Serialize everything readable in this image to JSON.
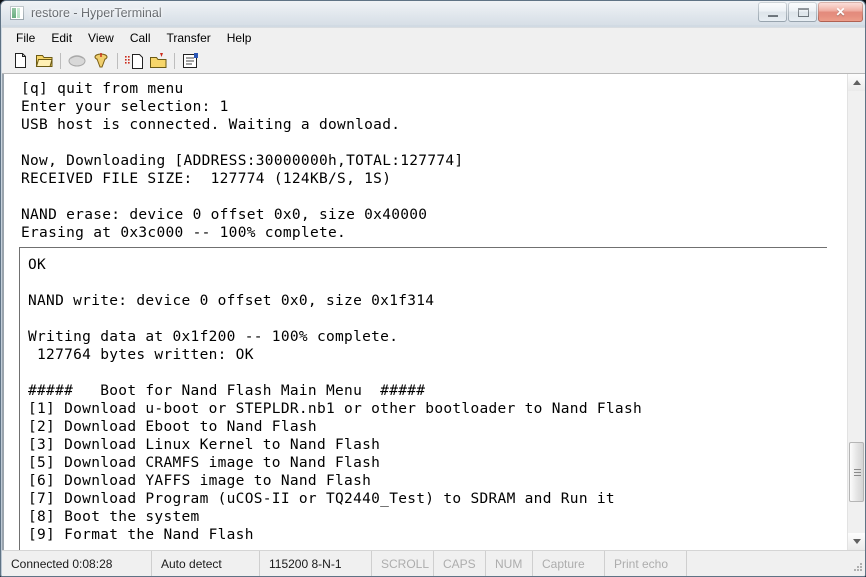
{
  "window": {
    "title": "restore - HyperTerminal",
    "icon": "hyperterminal-icon",
    "buttons": {
      "minimize": "minimize-button",
      "maximize": "maximize-button",
      "close": "✕"
    }
  },
  "menubar": {
    "items": [
      "File",
      "Edit",
      "View",
      "Call",
      "Transfer",
      "Help"
    ]
  },
  "toolbar": {
    "buttons": [
      {
        "name": "new-connection-icon",
        "title": "New"
      },
      {
        "name": "open-folder-icon",
        "title": "Open"
      },
      {
        "name": "call-icon",
        "title": "Call"
      },
      {
        "name": "disconnect-icon",
        "title": "Disconnect"
      },
      {
        "name": "send-file-icon",
        "title": "Send"
      },
      {
        "name": "receive-file-icon",
        "title": "Receive"
      },
      {
        "name": "properties-icon",
        "title": "Properties"
      }
    ]
  },
  "terminal": {
    "top_lines": [
      "[q] quit from menu",
      "Enter your selection: 1",
      "USB host is connected. Waiting a download.",
      "",
      "Now, Downloading [ADDRESS:30000000h,TOTAL:127774]",
      "RECEIVED FILE SIZE:  127774 (124KB/S, 1S)",
      "",
      "NAND erase: device 0 offset 0x0, size 0x40000",
      "Erasing at 0x3c000 -- 100% complete."
    ],
    "inner_lines": [
      "OK",
      "",
      "NAND write: device 0 offset 0x0, size 0x1f314",
      "",
      "Writing data at 0x1f200 -- 100% complete.",
      " 127764 bytes written: OK",
      "",
      "#####   Boot for Nand Flash Main Menu  #####",
      "[1] Download u-boot or STEPLDR.nb1 or other bootloader to Nand Flash",
      "[2] Download Eboot to Nand Flash",
      "[3] Download Linux Kernel to Nand Flash",
      "[5] Download CRAMFS image to Nand Flash",
      "[6] Download YAFFS image to Nand Flash",
      "[7] Download Program (uCOS-II or TQ2440_Test) to SDRAM and Run it",
      "[8] Boot the system",
      "[9] Format the Nand Flash"
    ]
  },
  "scrollbar": {
    "up_arrow": "scroll-up-arrow",
    "down_arrow": "scroll-down-arrow",
    "thumb": "scroll-thumb"
  },
  "statusbar": {
    "connected": "Connected 0:08:28",
    "detect": "Auto detect",
    "settings": "115200 8-N-1",
    "scroll": "SCROLL",
    "caps": "CAPS",
    "num": "NUM",
    "capture": "Capture",
    "print_echo": "Print echo"
  },
  "colors": {
    "titlebar_start": "#d2dbe4",
    "titlebar_end": "#bcc8d4",
    "close_button": "#cf3a23",
    "terminal_bg": "#ffffff",
    "terminal_fg": "#000000",
    "status_dim": "#adadad"
  }
}
